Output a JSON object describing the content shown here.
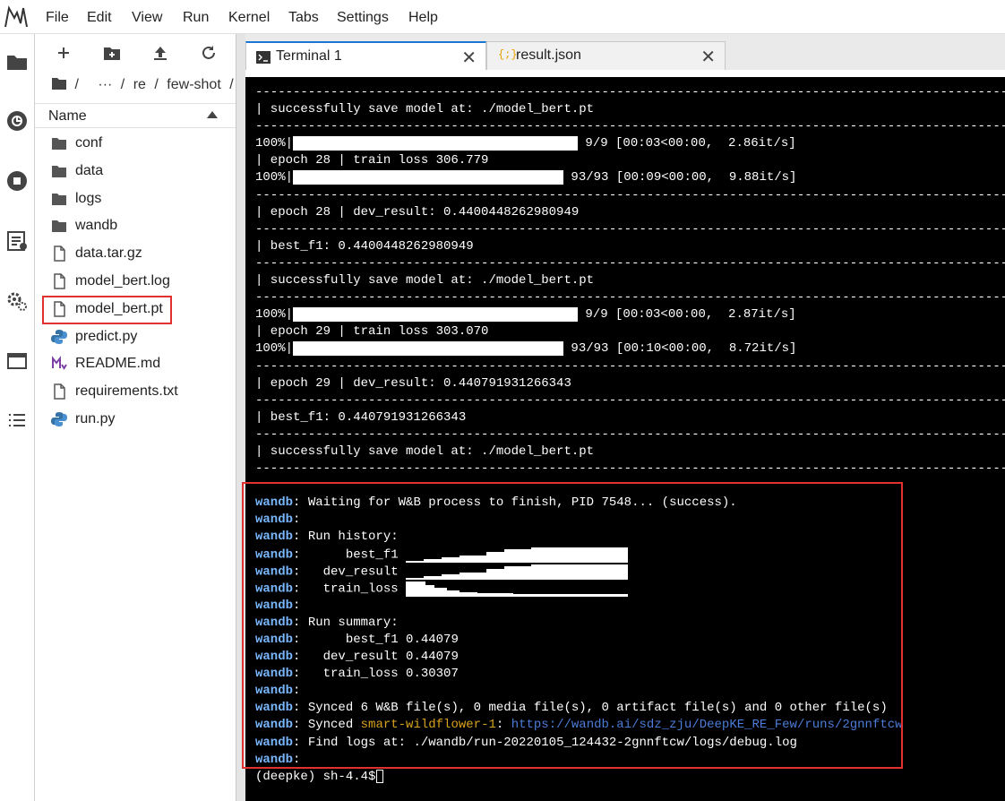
{
  "menu": [
    "File",
    "Edit",
    "View",
    "Run",
    "Kernel",
    "Tabs",
    "Settings",
    "Help"
  ],
  "filebrowser": {
    "breadcrumb": [
      "/",
      "···",
      "/",
      "re",
      "/",
      "few-shot",
      "/"
    ],
    "column_header": "Name",
    "files": [
      {
        "name": "conf",
        "icon": "folder-icon"
      },
      {
        "name": "data",
        "icon": "folder-icon"
      },
      {
        "name": "logs",
        "icon": "folder-icon"
      },
      {
        "name": "wandb",
        "icon": "folder-icon"
      },
      {
        "name": "data.tar.gz",
        "icon": "file-icon"
      },
      {
        "name": "model_bert.log",
        "icon": "file-icon"
      },
      {
        "name": "model_bert.pt",
        "icon": "file-icon"
      },
      {
        "name": "predict.py",
        "icon": "python-icon"
      },
      {
        "name": "README.md",
        "icon": "markdown-icon"
      },
      {
        "name": "requirements.txt",
        "icon": "file-icon"
      },
      {
        "name": "run.py",
        "icon": "python-icon"
      }
    ]
  },
  "tabs": [
    {
      "label": "Terminal 1",
      "icon": "terminal-icon",
      "active": true
    },
    {
      "label": "result.json",
      "icon": "json-icon",
      "active": false
    }
  ],
  "terminal": {
    "dash": "----------------------------------------------------------------------------------------------------",
    "lines": {
      "save1": "| successfully save model at: ./model_bert.pt",
      "pb1_pct": "100%|",
      "pb1_tail": " 9/9 [00:03<00:00,  2.86it/s]",
      "epoch28_train": "| epoch 28 | train loss 306.779",
      "pb2_pct": "100%|",
      "pb2_tail": " 93/93 [00:09<00:00,  9.88it/s]",
      "epoch28_dev": "| epoch 28 | dev_result: 0.4400448262980949",
      "best1": "| best_f1: 0.4400448262980949",
      "save2": "| successfully save model at: ./model_bert.pt",
      "pb3_pct": "100%|",
      "pb3_tail": " 9/9 [00:03<00:00,  2.87it/s]",
      "epoch29_train": "| epoch 29 | train loss 303.070",
      "pb4_pct": "100%|",
      "pb4_tail": " 93/93 [00:10<00:00,  8.72it/s]",
      "epoch29_dev": "| epoch 29 | dev_result: 0.440791931266343",
      "best2": "| best_f1: 0.440791931266343",
      "save3": "| successfully save model at: ./model_bert.pt"
    },
    "wandb_prefix": "wandb",
    "wandb": {
      "waiting": ": Waiting for W&B process to finish, PID 7548... (success).",
      "empty": ":",
      "history": ": Run history:",
      "h_best": ":      best_f1 ",
      "h_dev": ":   dev_result ",
      "h_train": ":   train_loss ",
      "summary": ": Run summary:",
      "s_best": ":      best_f1 0.44079",
      "s_dev": ":   dev_result 0.44079",
      "s_train": ":   train_loss 0.30307",
      "synced_files": ": Synced 6 W&B file(s), 0 media file(s), 0 artifact file(s) and 0 other file(s)",
      "synced_pre": ": Synced ",
      "run_name": "smart-wildflower-1",
      "run_sep": ": ",
      "run_url": "https://wandb.ai/sdz_zju/DeepKE_RE_Few/runs/2gnnftcw",
      "logs": ": Find logs at: ./wandb/run-20220105_124432-2gnnftcw/logs/debug.log"
    },
    "prompt": "(deepke) sh-4.4$"
  }
}
